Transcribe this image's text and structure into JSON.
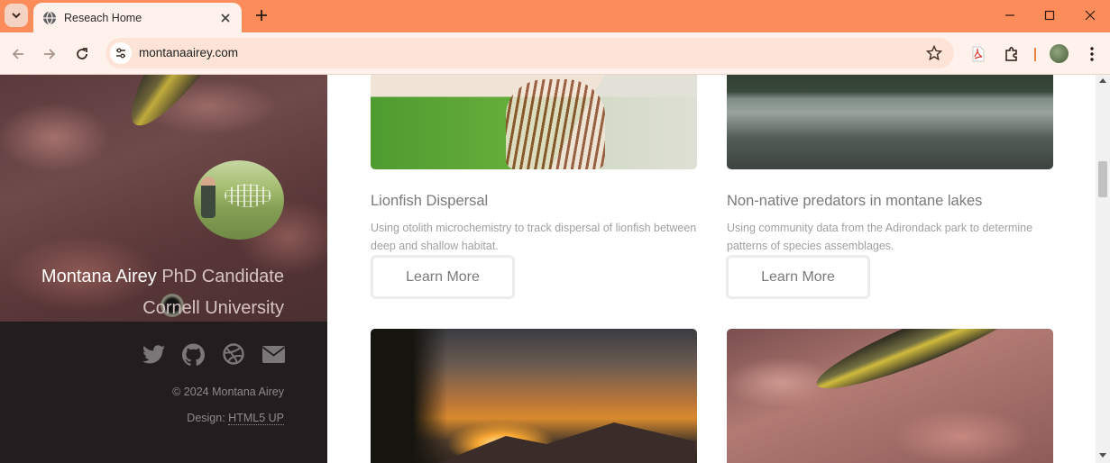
{
  "browser": {
    "tab": {
      "title": "Reseach Home"
    },
    "address_bar": {
      "url": "montanaairey.com"
    }
  },
  "profile": {
    "name": "Montana Airey",
    "role": "PhD Candidate",
    "institution": "Cornell University"
  },
  "footer": {
    "copyright": "© 2024 Montana Airey",
    "credit_prefix": "Design:",
    "credit_link": "HTML5 UP"
  },
  "projects": [
    {
      "title": "Lionfish Dispersal",
      "description": "Using otolith microchemistry to track dispersal of lionfish between deep and shallow habitat.",
      "button_label": "Learn More"
    },
    {
      "title": "Non-native predators in montane lakes",
      "description": "Using community data from the Adirondack park to determine patterns of species assemblages.",
      "button_label": "Learn More"
    }
  ],
  "icons": {
    "social": [
      "twitter-icon",
      "github-icon",
      "dribbble-icon",
      "envelope-icon"
    ]
  },
  "colors": {
    "tabbar": "#fd8c5b",
    "toolbar": "#fff1eb",
    "sidebar_footer": "#231d1f",
    "muted_text": "#a0a0a0"
  }
}
